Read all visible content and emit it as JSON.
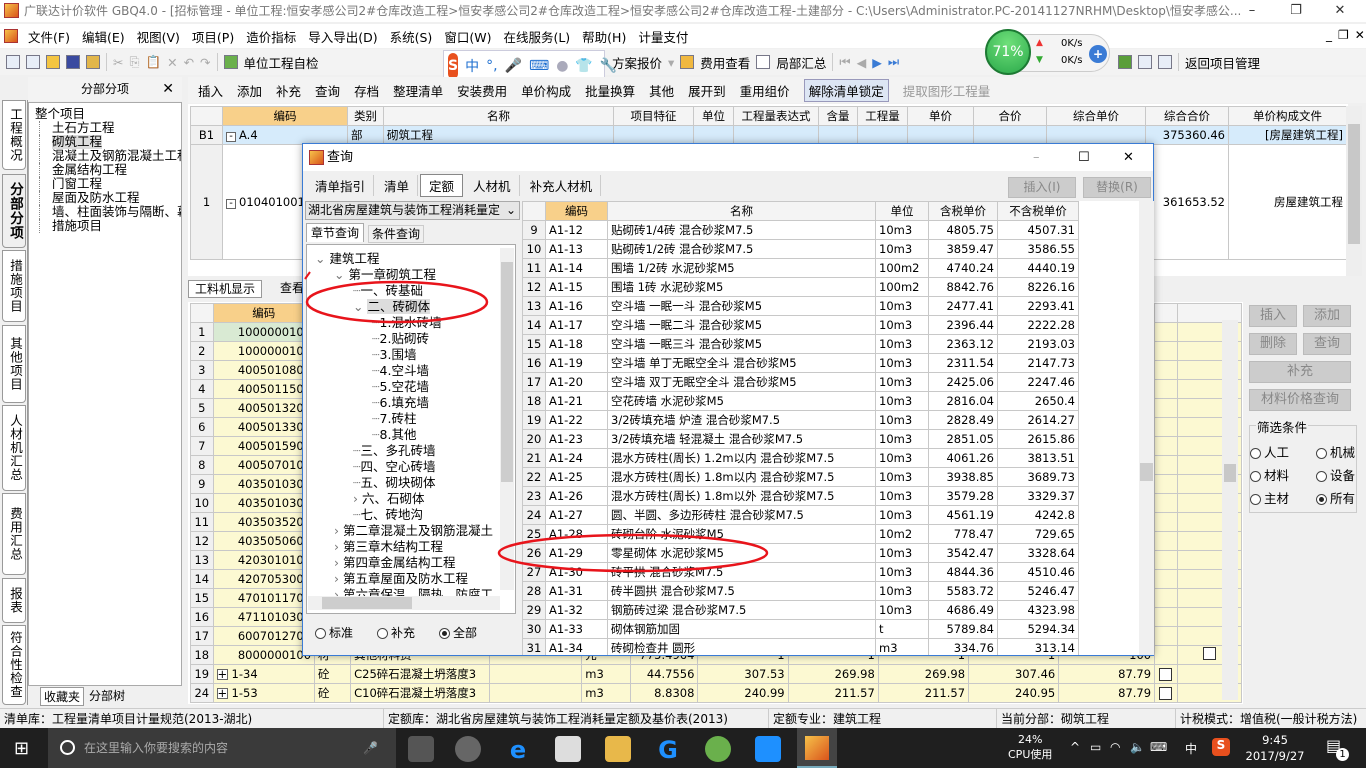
{
  "window": {
    "title": "广联达计价软件 GBQ4.0 - [招标管理 - 单位工程:恒安孝感公司2#仓库改造工程>恒安孝感公司2#仓库改造工程>恒安孝感公司2#仓库改造工程-土建部分 - C:\\Users\\Administrator.PC-20141127NRHM\\Desktop\\恒安孝感公..."
  },
  "menu": [
    "文件(F)",
    "编辑(E)",
    "视图(V)",
    "项目(P)",
    "造价指标",
    "导入导出(D)",
    "系统(S)",
    "窗口(W)",
    "在线服务(L)",
    "帮助(H)",
    "计量支付"
  ],
  "toolbar1": {
    "self_check": "单位工程自检",
    "plan_quote": "方案报价",
    "fee_view": "费用查看",
    "partial_sum": "局部汇总",
    "back": "返回项目管理"
  },
  "toolbar2": [
    "插入",
    "添加",
    "补充",
    "查询",
    "存档",
    "整理清单",
    "安装费用",
    "单价构成",
    "批量换算",
    "其他",
    "展开到",
    "重用组价",
    "解除清单锁定",
    "提取图形工程量"
  ],
  "network_widget": {
    "percent": "71%",
    "up": "0K/s",
    "down": "0K/s"
  },
  "left_panel": {
    "title": "分部分项",
    "vertical_tabs": [
      "工程概况",
      "分部分项",
      "措施项目",
      "其他项目",
      "人材机汇总",
      "费用汇总",
      "报表",
      "符合性检查"
    ],
    "tree_root": "整个项目",
    "tree_items": [
      "土石方工程",
      "砌筑工程",
      "混凝土及钢筋混凝土工程",
      "金属结构工程",
      "门窗工程",
      "屋面及防水工程",
      "墙、柱面装饰与隔断、幕",
      "措施项目"
    ],
    "selected": "砌筑工程",
    "bottom_tabs": [
      "收藏夹",
      "分部树"
    ]
  },
  "main_grid": {
    "columns": [
      "",
      "编码",
      "类别",
      "名称",
      "项目特征",
      "单位",
      "工程量表达式",
      "含量",
      "工程量",
      "单价",
      "合价",
      "综合单价",
      "综合合价",
      "单价构成文件"
    ],
    "rows": [
      [
        "B1",
        "A.4",
        "部",
        "砌筑工程",
        "",
        "",
        "",
        "",
        "",
        "",
        "",
        "",
        "375360.46",
        "[房屋建筑工程]"
      ],
      [
        "1",
        "010401001",
        "",
        "",
        "",
        "",
        "",
        "",
        "",
        "",
        "",
        "",
        "361653.52",
        "房屋建筑工程"
      ]
    ]
  },
  "lower_panel": {
    "tabs": [
      "工料机显示",
      "查看"
    ],
    "code_header": "编码",
    "codes": [
      "1000000100",
      "1000000100",
      "4005010802",
      "4005011500",
      "4005013200",
      "4005013300",
      "4005015900",
      "4005070100",
      "4035010300",
      "4035010300",
      "4035035200",
      "4035050600",
      "4203010103",
      "4207053000",
      "4701011700",
      "4711010300",
      "6007012700",
      "8000000100"
    ],
    "row18_rest": [
      "材",
      "其他材料费",
      "",
      "元",
      "775.4964",
      "1",
      "1",
      "1",
      "1",
      "100"
    ],
    "extra_rows": [
      {
        "num": "19",
        "code": "1-34",
        "type": "砼",
        "name": "C25碎石混凝土坍落度3",
        "unit": "m3",
        "qty": "44.7556",
        "v1": "307.53",
        "v2": "269.98",
        "v3": "269.98",
        "v4": "307.46",
        "v5": "87.79"
      },
      {
        "num": "24",
        "code": "1-53",
        "type": "砼",
        "name": "C10碎石混凝土坍落度3",
        "unit": "m3",
        "qty": "8.8308",
        "v1": "240.99",
        "v2": "211.57",
        "v3": "211.57",
        "v4": "240.95",
        "v5": "87.79"
      }
    ]
  },
  "right_panel": {
    "buttons": [
      "插入",
      "添加",
      "删除",
      "查询",
      "补充",
      "材料价格查询"
    ],
    "filter_title": "筛选条件",
    "filters": [
      {
        "label": "人工",
        "checked": false
      },
      {
        "label": "机械",
        "checked": false
      },
      {
        "label": "材料",
        "checked": false
      },
      {
        "label": "设备",
        "checked": false
      },
      {
        "label": "主材",
        "checked": false
      },
      {
        "label": "所有",
        "checked": true
      }
    ]
  },
  "dialog": {
    "title": "查询",
    "tabs": [
      "清单指引",
      "清单",
      "定额",
      "人材机",
      "补充人材机"
    ],
    "active_tab": "定额",
    "insert": "插入(I)",
    "replace": "替换(R)",
    "library": "湖北省房屋建筑与装饰工程消耗量定",
    "subtabs": [
      "章节查询",
      "条件查询"
    ],
    "tree": [
      {
        "level": 0,
        "exp": "open",
        "label": "建筑工程"
      },
      {
        "level": 1,
        "exp": "open",
        "label": "第一章砌筑工程"
      },
      {
        "level": 2,
        "exp": "",
        "label": "一、砖基础"
      },
      {
        "level": 2,
        "exp": "open",
        "label": "二、砖砌体",
        "selected": true
      },
      {
        "level": 3,
        "exp": "",
        "label": "1.混水砖墙"
      },
      {
        "level": 3,
        "exp": "",
        "label": "2.贴砌砖"
      },
      {
        "level": 3,
        "exp": "",
        "label": "3.围墙"
      },
      {
        "level": 3,
        "exp": "",
        "label": "4.空斗墙"
      },
      {
        "level": 3,
        "exp": "",
        "label": "5.空花墙"
      },
      {
        "level": 3,
        "exp": "",
        "label": "6.填充墙"
      },
      {
        "level": 3,
        "exp": "",
        "label": "7.砖柱"
      },
      {
        "level": 3,
        "exp": "",
        "label": "8.其他"
      },
      {
        "level": 2,
        "exp": "",
        "label": "三、多孔砖墙"
      },
      {
        "level": 2,
        "exp": "",
        "label": "四、空心砖墙"
      },
      {
        "level": 2,
        "exp": "",
        "label": "五、砌块砌体"
      },
      {
        "level": 2,
        "exp": "closed",
        "label": "六、石砌体"
      },
      {
        "level": 2,
        "exp": "",
        "label": "七、砖地沟"
      },
      {
        "level": 1,
        "exp": "closed",
        "label": "第二章混凝土及钢筋混凝土"
      },
      {
        "level": 1,
        "exp": "closed",
        "label": "第三章木结构工程"
      },
      {
        "level": 1,
        "exp": "closed",
        "label": "第四章金属结构工程"
      },
      {
        "level": 1,
        "exp": "closed",
        "label": "第五章屋面及防水工程"
      },
      {
        "level": 1,
        "exp": "closed",
        "label": "第六章保温、隔热、防腐工"
      }
    ],
    "radios": [
      {
        "label": "标准",
        "checked": false
      },
      {
        "label": "补充",
        "checked": false
      },
      {
        "label": "全部",
        "checked": true
      }
    ],
    "table_columns": [
      "",
      "编码",
      "名称",
      "单位",
      "含税单价",
      "不含税单价"
    ],
    "rows": [
      [
        "9",
        "A1-12",
        "贴砌砖1/4砖 混合砂浆M7.5",
        "10m3",
        "4805.75",
        "4507.31"
      ],
      [
        "10",
        "A1-13",
        "贴砌砖1/2砖 混合砂浆M7.5",
        "10m3",
        "3859.47",
        "3586.55"
      ],
      [
        "11",
        "A1-14",
        "围墙 1/2砖 水泥砂浆M5",
        "100m2",
        "4740.24",
        "4440.19"
      ],
      [
        "12",
        "A1-15",
        "围墙 1砖 水泥砂浆M5",
        "100m2",
        "8842.76",
        "8226.16"
      ],
      [
        "13",
        "A1-16",
        "空斗墙 一眠一斗 混合砂浆M5",
        "10m3",
        "2477.41",
        "2293.41"
      ],
      [
        "14",
        "A1-17",
        "空斗墙 一眠二斗 混合砂浆M5",
        "10m3",
        "2396.44",
        "2222.28"
      ],
      [
        "15",
        "A1-18",
        "空斗墙 一眠三斗 混合砂浆M5",
        "10m3",
        "2363.12",
        "2193.03"
      ],
      [
        "16",
        "A1-19",
        "空斗墙 单丁无眠空全斗 混合砂浆M5",
        "10m3",
        "2311.54",
        "2147.73"
      ],
      [
        "17",
        "A1-20",
        "空斗墙 双丁无眠空全斗 混合砂浆M5",
        "10m3",
        "2425.06",
        "2247.46"
      ],
      [
        "18",
        "A1-21",
        "空花砖墙 水泥砂浆M5",
        "10m3",
        "2816.04",
        "2650.4"
      ],
      [
        "19",
        "A1-22",
        "3/2砖填充墙 炉渣 混合砂浆M7.5",
        "10m3",
        "2828.49",
        "2614.27"
      ],
      [
        "20",
        "A1-23",
        "3/2砖填充墙 轻混凝土 混合砂浆M7.5",
        "10m3",
        "2851.05",
        "2615.86"
      ],
      [
        "21",
        "A1-24",
        "混水方砖柱(周长) 1.2m以内 混合砂浆M7.5",
        "10m3",
        "4061.26",
        "3813.51"
      ],
      [
        "22",
        "A1-25",
        "混水方砖柱(周长) 1.8m以内 混合砂浆M7.5",
        "10m3",
        "3938.85",
        "3689.73"
      ],
      [
        "23",
        "A1-26",
        "混水方砖柱(周长) 1.8m以外 混合砂浆M7.5",
        "10m3",
        "3579.28",
        "3329.37"
      ],
      [
        "24",
        "A1-27",
        "圆、半圆、多边形砖柱 混合砂浆M7.5",
        "10m3",
        "4561.19",
        "4242.8"
      ],
      [
        "25",
        "A1-28",
        "砖砌台阶 水泥砂浆M5",
        "10m2",
        "778.47",
        "729.65"
      ],
      [
        "26",
        "A1-29",
        "零星砌体 水泥砂浆M5",
        "10m3",
        "3542.47",
        "3328.64"
      ],
      [
        "27",
        "A1-30",
        "砖平拱 混合砂浆M7.5",
        "10m3",
        "4844.36",
        "4510.46"
      ],
      [
        "28",
        "A1-31",
        "砖半圆拱 混合砂浆M7.5",
        "10m3",
        "5583.72",
        "5246.47"
      ],
      [
        "29",
        "A1-32",
        "钢筋砖过梁 混合砂浆M7.5",
        "10m3",
        "4686.49",
        "4323.98"
      ],
      [
        "30",
        "A1-33",
        "砌体钢筋加固",
        "t",
        "5789.84",
        "5294.34"
      ],
      [
        "31",
        "A1-34",
        "砖砌检查井 圆形",
        "m3",
        "334.76",
        "313.14"
      ]
    ]
  },
  "annotation_color": "#e8141b",
  "status": {
    "bill_lib": "清单库：工程量清单项目计量规范(2013-湖北)",
    "quota_lib": "定额库：湖北省房屋建筑与装饰工程消耗量定额及基价表(2013)",
    "quota_major": "定额专业：建筑工程",
    "current": "当前分部：砌筑工程",
    "tax_mode": "计税模式：增值税(一般计税方法)"
  },
  "taskbar": {
    "search_placeholder": "在这里输入你要搜索的内容",
    "cpu": "24%",
    "cpu_label": "CPU使用",
    "ime": "中",
    "time": "9:45",
    "date": "2017/9/27",
    "notifications": "1"
  }
}
